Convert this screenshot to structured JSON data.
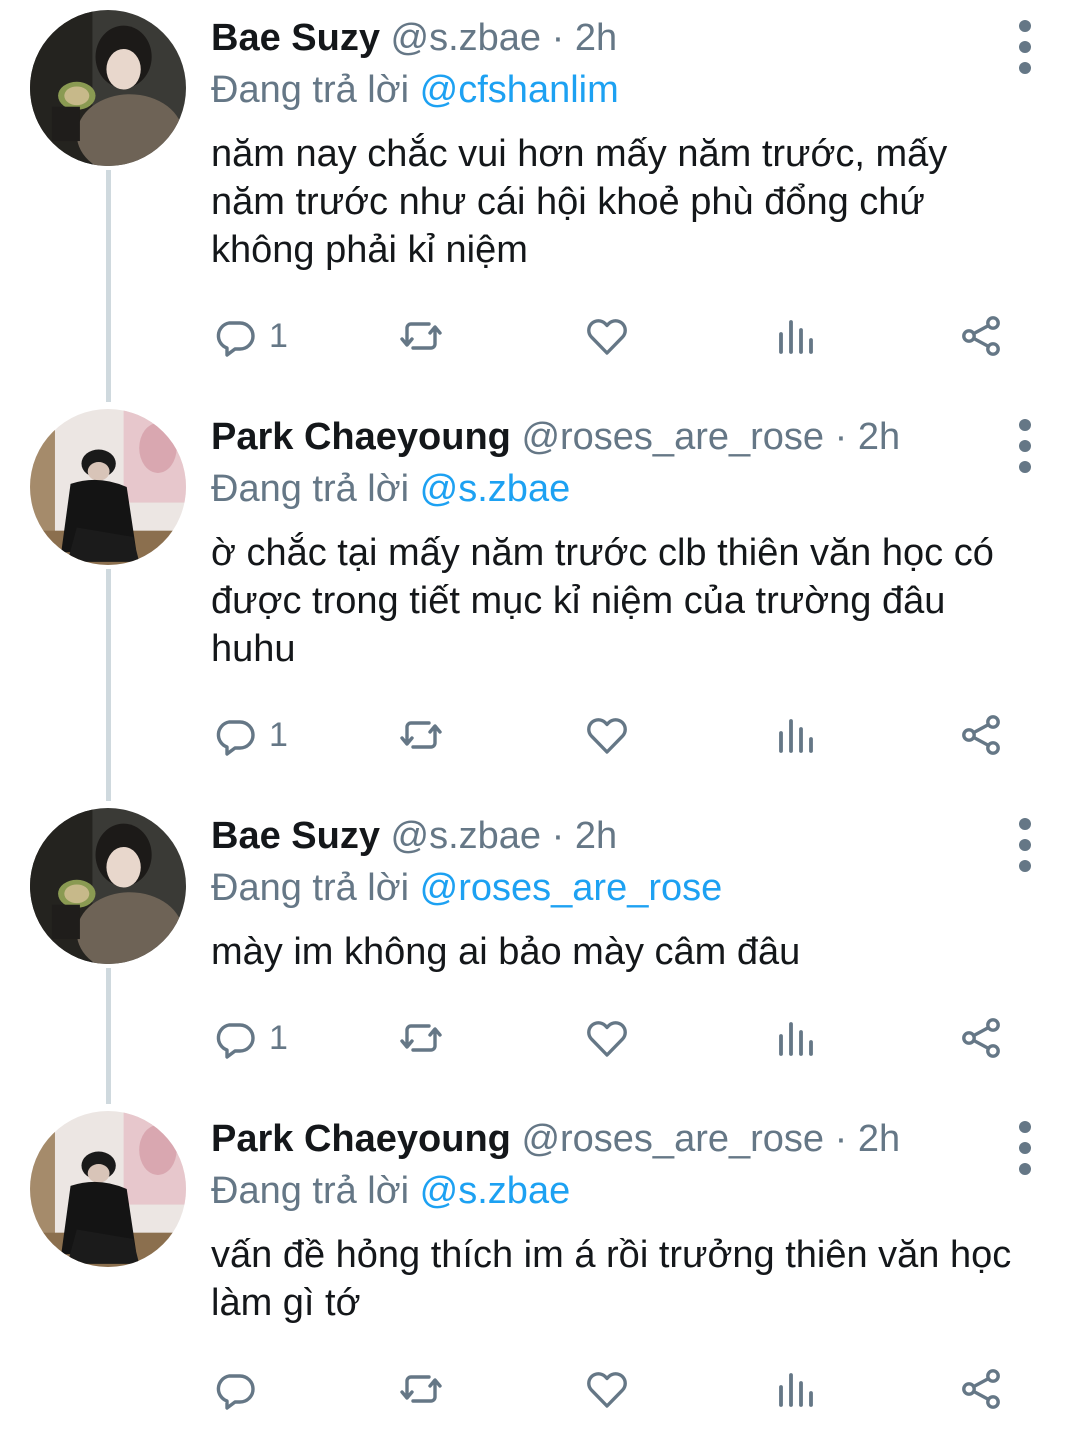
{
  "reply_prefix": "Đang trả lời",
  "colors": {
    "mention": "#1da1f2",
    "muted": "#657786",
    "thread_line": "#cfd9de"
  },
  "tweets": [
    {
      "name": "Bae Suzy",
      "handle": "@s.zbae",
      "sep": "·",
      "time": "2h",
      "reply_to": "@cfshanlim",
      "text": "năm nay chắc vui hơn mấy năm trước, mấy năm trước như cái hội khoẻ phù đổng chứ không phải kỉ niệm",
      "reply_count": "1"
    },
    {
      "name": "Park Chaeyoung",
      "handle": "@roses_are_rose",
      "sep": "·",
      "time": "2h",
      "reply_to": "@s.zbae",
      "text": "ờ chắc tại mấy năm trước clb thiên văn học có được trong tiết mục kỉ niệm của trường đâu huhu",
      "reply_count": "1"
    },
    {
      "name": "Bae Suzy",
      "handle": "@s.zbae",
      "sep": "·",
      "time": "2h",
      "reply_to": "@roses_are_rose",
      "text": "mày im không ai bảo mày câm đâu",
      "reply_count": "1"
    },
    {
      "name": "Park Chaeyoung",
      "handle": "@roses_are_rose",
      "sep": "·",
      "time": "2h",
      "reply_to": "@s.zbae",
      "text": "vấn đề hỏng thích im á rồi trưởng thiên văn học làm gì tớ",
      "reply_count": ""
    }
  ]
}
